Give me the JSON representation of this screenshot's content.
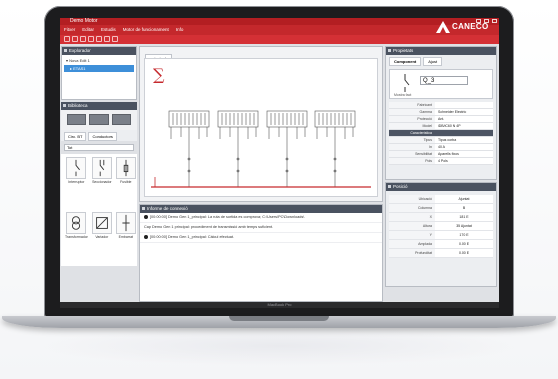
{
  "app": {
    "title": "Demo Motor",
    "menu": [
      "Fitxer",
      "Editar",
      "Estudis",
      "Motor de funcionament",
      "Info"
    ],
    "brand": "CANECO",
    "colors": {
      "brand_red": "#c4282c",
      "panel_dark": "#4a5260",
      "selection_blue": "#3d8fd9"
    }
  },
  "explorer": {
    "title": "Explorador",
    "root": "Nova Edit 1",
    "child": "ETAS1"
  },
  "library": {
    "title": "Biblioteca",
    "tabs": [
      "Circ. BT",
      "Conductors"
    ],
    "filter": "Tot",
    "items": [
      {
        "label": "Interruptor"
      },
      {
        "label": "Seccionador"
      },
      {
        "label": "Fusible"
      },
      {
        "label": "Transformador"
      },
      {
        "label": "Variador"
      },
      {
        "label": "Embarrat"
      }
    ]
  },
  "document": {
    "tab": "principal"
  },
  "console": {
    "title": "Informe de connexió",
    "messages": [
      "[00:00:00] Demo Gen 1_principal: La ruta de sortida es comprova; C:\\Users\\PC\\Downloads\\",
      "[00:00:00] Demo Gen 1_principal: Càlcul efectuat.",
      "Cap Demo Gen 1 principal: procediment de transmissió amb temps suficient.",
      "[00:00:00] Demo Gen 1_principal: Càlcul efectuat."
    ]
  },
  "properties": {
    "title": "Propietats",
    "tabs": [
      "Component",
      "Ajust"
    ],
    "name": "Q_3",
    "subtitle": "Mostra fact",
    "rows": [
      {
        "k": "Fabricant",
        "v": ""
      },
      {
        "k": "Gamma",
        "v": "Schneider Electric"
      },
      {
        "k": "Protecció",
        "v": "Ant."
      },
      {
        "k": "Model",
        "v": "iDB/iC60 N 4P"
      },
      {
        "k": "Característica",
        "v": ""
      },
      {
        "k": "Tipus",
        "v": "Tipus corba"
      },
      {
        "k": "In",
        "v": "40 A"
      },
      {
        "k": "Sensibilitat",
        "v": "Aparells fixos"
      },
      {
        "k": "Pols",
        "v": "4 Pols"
      }
    ]
  },
  "position": {
    "title": "Posició",
    "rows": [
      {
        "k": "Ubicació",
        "v": "Ajuntat"
      },
      {
        "k": "Columna",
        "v": "B"
      },
      {
        "k": "X",
        "v": "181 E"
      },
      {
        "k": "Altura",
        "v": "35 Ajuntat"
      },
      {
        "k": "Y",
        "v": "170 E"
      },
      {
        "k": "Amplada",
        "v": "0.00 E"
      },
      {
        "k": "Profunditat",
        "v": "0.00 E"
      }
    ]
  },
  "laptop": {
    "label": "MacBook Pro"
  }
}
